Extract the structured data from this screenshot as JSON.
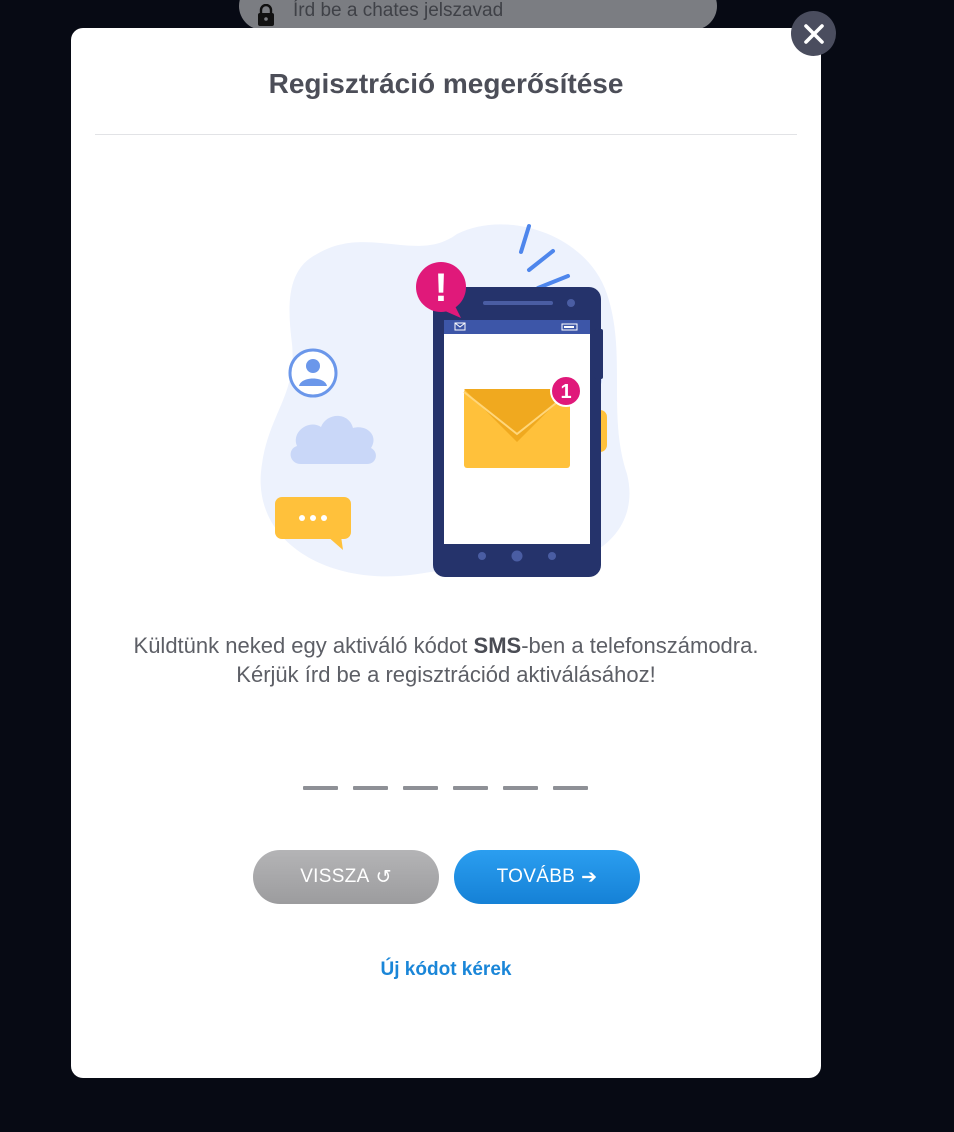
{
  "background": {
    "password_placeholder": "Írd be a chates jelszavad"
  },
  "modal": {
    "title": "Regisztráció megerősítése",
    "message_part1": "Küldtünk neked egy aktiváló kódot ",
    "message_bold": "SMS",
    "message_part2": "-ben a telefonszámodra.",
    "message_line2": "Kérjük írd be a regisztrációd aktiválásához!",
    "code_length": 6,
    "back_label": "VISSZA",
    "back_icon": "↺",
    "next_label": "TOVÁBB",
    "next_icon": "➔",
    "resend_label": "Új kódot kérek",
    "illustration": {
      "alert_badge": "!",
      "envelope_badge": "1"
    }
  },
  "colors": {
    "accent": "#1a86d8",
    "brand_pink": "#e0197a",
    "phone": "#25336b",
    "envelope": "#ffc13b"
  }
}
